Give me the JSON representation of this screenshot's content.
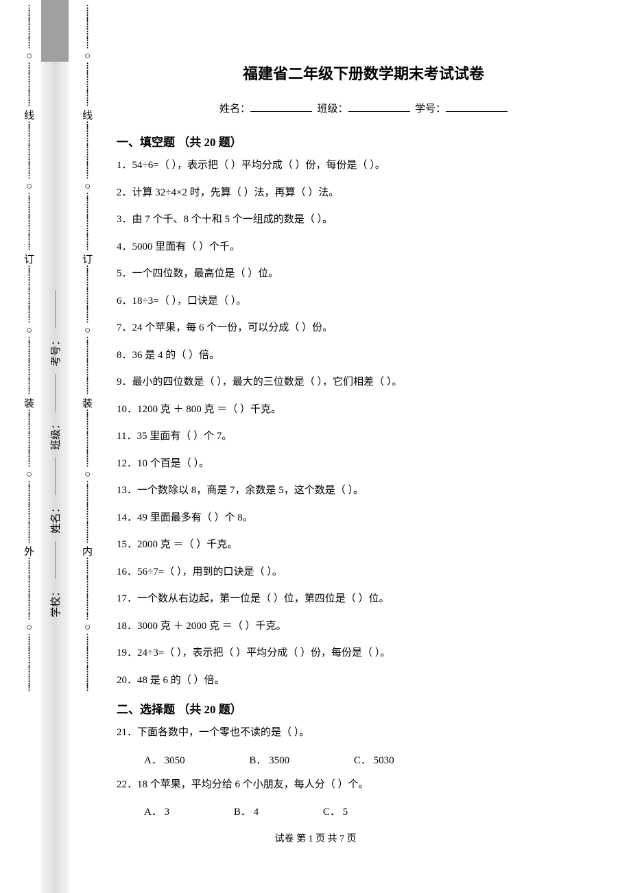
{
  "title": "福建省二年级下册数学期末考试试卷",
  "info": {
    "name_label": "姓名：",
    "class_label": "班级：",
    "id_label": "学号："
  },
  "binding": {
    "outer_char": "外",
    "inner_char": "内",
    "seal_chars": [
      "线",
      "订",
      "装"
    ],
    "info_labels": [
      "考号：",
      "班级：",
      "姓名：",
      "学校："
    ]
  },
  "section1": {
    "header": "一、填空题 （共 20 题）",
    "questions": [
      "1．54÷6=（  ），表示把（  ）平均分成（  ）份，每份是（  ）。",
      "2．计算 32÷4×2 时，先算（  ）法，再算（  ）法。",
      "3．由 7 个千、8 个十和 5 个一组成的数是（  ）。",
      "4．5000 里面有（  ）个千。",
      "5．一个四位数，最高位是（  ）位。",
      "6．18÷3=（  ），口诀是（  ）。",
      "7．24 个苹果，每 6 个一份，可以分成（  ）份。",
      "8．36 是 4 的（  ）倍。",
      "9．最小的四位数是（  ），最大的三位数是（  ），它们相差（  ）。",
      "10．1200 克 ＋ 800 克 ＝（  ）千克。",
      "11．35 里面有（  ）个 7。",
      "12．10 个百是（  ）。",
      "13．一个数除以 8，商是 7，余数是 5，这个数是（  ）。",
      "14．49 里面最多有（  ）个 8。",
      "15．2000 克 ＝（  ）千克。",
      "16．56÷7=（  ），用到的口诀是（  ）。",
      "17．一个数从右边起，第一位是（  ）位，第四位是（  ）位。",
      "18．3000 克 ＋ 2000 克 ＝（  ）千克。",
      "19．24÷3=（  ），表示把（  ）平均分成（  ）份，每份是（  ）。",
      "20．48 是 6 的（  ）倍。"
    ]
  },
  "section2": {
    "header": "二、选择题 （共 20 题）",
    "q21": {
      "stem": "21．下面各数中，一个零也不读的是（  ）。",
      "opts": [
        "A． 3050",
        "B． 3500",
        "C． 5030"
      ]
    },
    "q22": {
      "stem": "22．18 个苹果，平均分给 6 个小朋友，每人分（  ）个。",
      "opts": [
        "A． 3",
        "B． 4",
        "C． 5"
      ]
    }
  },
  "footer": "试卷 第 1 页 共 7 页"
}
